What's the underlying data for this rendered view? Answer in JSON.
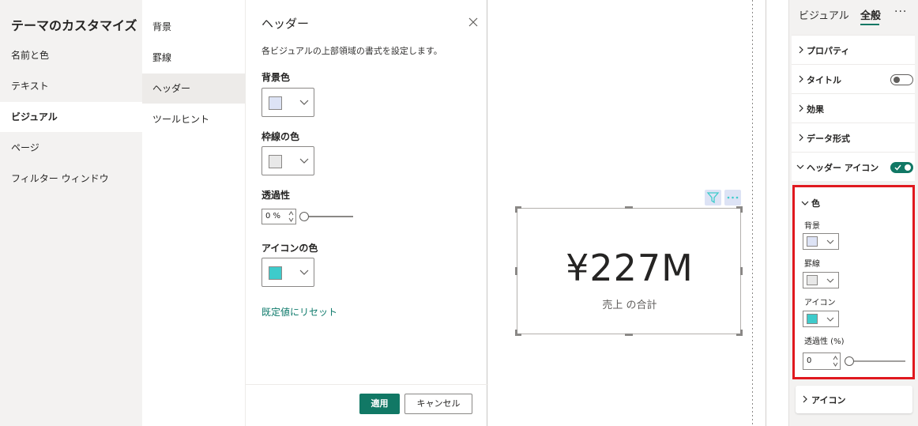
{
  "dialog": {
    "title": "テーマのカスタマイズ",
    "nav1": [
      {
        "label": "名前と色"
      },
      {
        "label": "テキスト"
      },
      {
        "label": "ビジュアル",
        "active": true
      },
      {
        "label": "ページ"
      },
      {
        "label": "フィルター ウィンドウ"
      }
    ],
    "nav2": [
      {
        "label": "背景"
      },
      {
        "label": "罫線"
      },
      {
        "label": "ヘッダー",
        "active": true
      },
      {
        "label": "ツールヒント"
      }
    ],
    "detail": {
      "title": "ヘッダー",
      "description": "各ビジュアルの上部領域の書式を設定します。",
      "bg_color_label": "背景色",
      "bg_color": "#dde3f5",
      "border_color_label": "枠線の色",
      "border_color": "#e8e8e8",
      "transparency_label": "透過性",
      "transparency_value": "0 %",
      "icon_color_label": "アイコンの色",
      "icon_color": "#3ecbcb",
      "reset_link": "既定値にリセット"
    },
    "apply_label": "適用",
    "cancel_label": "キャンセル"
  },
  "visual": {
    "value": "¥227M",
    "label": "売上 の合計",
    "filter_icon": "filter-icon",
    "more_icon": "more-options-icon"
  },
  "pane": {
    "tabs": [
      {
        "label": "ビジュアル"
      },
      {
        "label": "全般",
        "active": true
      }
    ],
    "more": "···",
    "sections": [
      {
        "label": "プロパティ",
        "expanded": false
      },
      {
        "label": "タイトル",
        "expanded": false,
        "toggle": "off"
      },
      {
        "label": "効果",
        "expanded": false
      },
      {
        "label": "データ形式",
        "expanded": false
      },
      {
        "label": "ヘッダー アイコン",
        "expanded": true,
        "toggle": "on"
      }
    ],
    "color_group": {
      "title": "色",
      "background_label": "背景",
      "background_color": "#dde3f5",
      "border_label": "罫線",
      "border_color": "#e8e8e8",
      "icon_label": "アイコン",
      "icon_color": "#3ecbcb",
      "transparency_label": "透過性 (%)",
      "transparency_value": "0"
    },
    "icon_section": {
      "label": "アイコン"
    }
  },
  "colors": {
    "accent": "#117865",
    "highlight_border": "#e0181e"
  }
}
